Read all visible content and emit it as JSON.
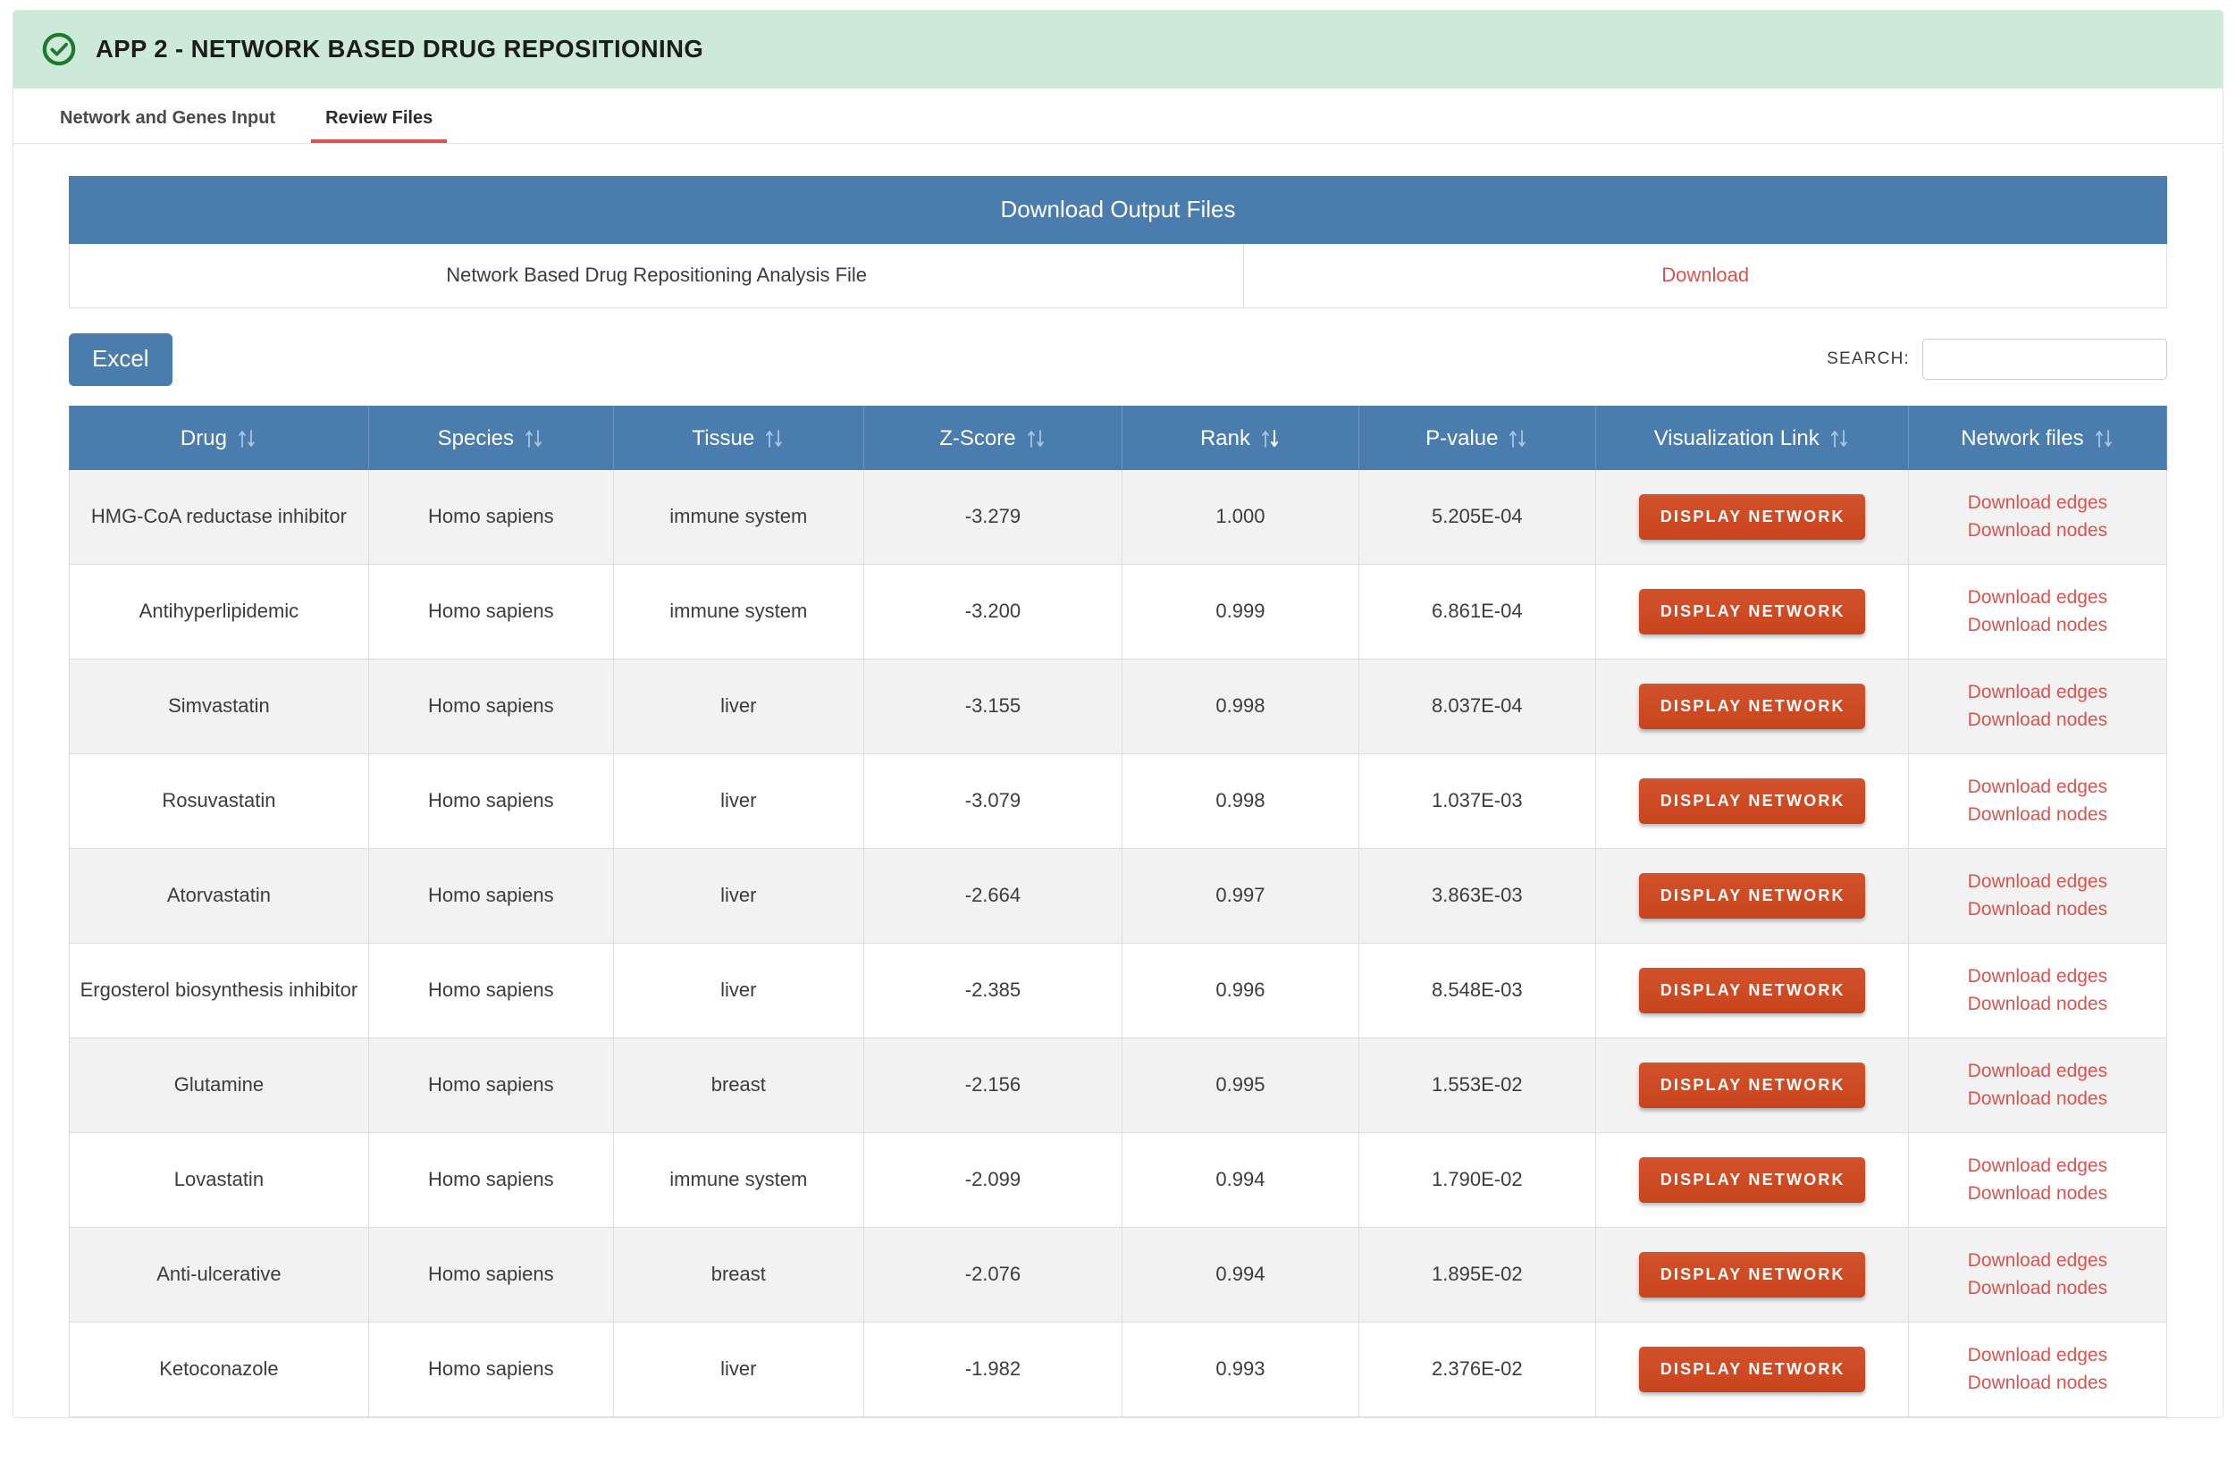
{
  "app": {
    "title": "APP 2 - NETWORK BASED DRUG REPOSITIONING",
    "status_icon": "check-circle-icon",
    "header_bg": "#cdead8",
    "accent_red": "#d9534f",
    "accent_blue": "#4a7cad",
    "button_orange": "#cf4b25"
  },
  "tabs": [
    {
      "label": "Network and Genes Input",
      "active": false
    },
    {
      "label": "Review Files",
      "active": true
    }
  ],
  "download_panel": {
    "title": "Download Output Files",
    "file_label": "Network Based Drug Repositioning Analysis File",
    "download_label": "Download"
  },
  "toolbar": {
    "excel_label": "Excel",
    "search_label": "SEARCH:",
    "search_value": "",
    "search_placeholder": ""
  },
  "table": {
    "columns": [
      {
        "label": "Drug",
        "sort": "none"
      },
      {
        "label": "Species",
        "sort": "none"
      },
      {
        "label": "Tissue",
        "sort": "none"
      },
      {
        "label": "Z-Score",
        "sort": "none"
      },
      {
        "label": "Rank",
        "sort": "desc"
      },
      {
        "label": "P-value",
        "sort": "none"
      },
      {
        "label": "Visualization Link",
        "sort": "none"
      },
      {
        "label": "Network files",
        "sort": "none"
      }
    ],
    "network_button_label": "DISPLAY NETWORK",
    "edges_label": "Download edges",
    "nodes_label": "Download nodes",
    "rows": [
      {
        "drug": "HMG-CoA reductase inhibitor",
        "species": "Homo sapiens",
        "tissue": "immune system",
        "zscore": "-3.279",
        "rank": "1.000",
        "pvalue": "5.205E-04"
      },
      {
        "drug": "Antihyperlipidemic",
        "species": "Homo sapiens",
        "tissue": "immune system",
        "zscore": "-3.200",
        "rank": "0.999",
        "pvalue": "6.861E-04"
      },
      {
        "drug": "Simvastatin",
        "species": "Homo sapiens",
        "tissue": "liver",
        "zscore": "-3.155",
        "rank": "0.998",
        "pvalue": "8.037E-04"
      },
      {
        "drug": "Rosuvastatin",
        "species": "Homo sapiens",
        "tissue": "liver",
        "zscore": "-3.079",
        "rank": "0.998",
        "pvalue": "1.037E-03"
      },
      {
        "drug": "Atorvastatin",
        "species": "Homo sapiens",
        "tissue": "liver",
        "zscore": "-2.664",
        "rank": "0.997",
        "pvalue": "3.863E-03"
      },
      {
        "drug": "Ergosterol biosynthesis inhibitor",
        "species": "Homo sapiens",
        "tissue": "liver",
        "zscore": "-2.385",
        "rank": "0.996",
        "pvalue": "8.548E-03"
      },
      {
        "drug": "Glutamine",
        "species": "Homo sapiens",
        "tissue": "breast",
        "zscore": "-2.156",
        "rank": "0.995",
        "pvalue": "1.553E-02"
      },
      {
        "drug": "Lovastatin",
        "species": "Homo sapiens",
        "tissue": "immune system",
        "zscore": "-2.099",
        "rank": "0.994",
        "pvalue": "1.790E-02"
      },
      {
        "drug": "Anti-ulcerative",
        "species": "Homo sapiens",
        "tissue": "breast",
        "zscore": "-2.076",
        "rank": "0.994",
        "pvalue": "1.895E-02"
      },
      {
        "drug": "Ketoconazole",
        "species": "Homo sapiens",
        "tissue": "liver",
        "zscore": "-1.982",
        "rank": "0.993",
        "pvalue": "2.376E-02"
      }
    ]
  }
}
